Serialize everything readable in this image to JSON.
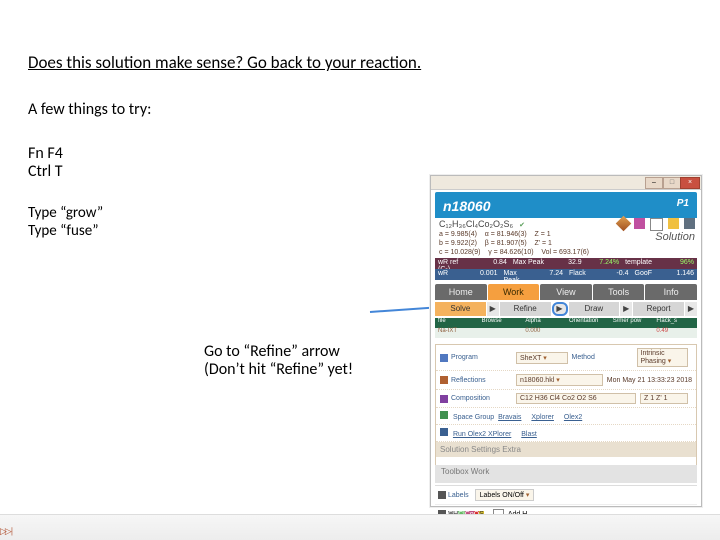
{
  "text": {
    "title": "Does this solution make sense? Go back to your reaction.",
    "subtitle": "A few things to try:",
    "l3": "Fn F4",
    "l4": "Ctrl T",
    "l5": "Type “grow”",
    "l6": "Type “fuse”",
    "l7": "Go to “Refine” arrow",
    "l8": "(Don’t hit “Refine” yet!"
  },
  "app": {
    "title": "n18060",
    "p1": "P1",
    "winbtns": {
      "min": "–",
      "max": "□",
      "close": "×"
    },
    "formula": "C₁₂H₃₆Cl₄Co₂O₂S₆",
    "unit_raw": "a = 9.985(4)    α = 81.946(3)    Z = 1\nb = 9.922(2)    β = 81.907(5)    Z' = 1\nc = 10.028(9)    γ = 84.626(10)    Vol = 693.17(6)",
    "sol_tag": "Solution",
    "stats": {
      "wrA": {
        "label": "wR ref (C-)",
        "val": "0.84"
      },
      "maxpA": {
        "label": "Max Peak",
        "val": "32.9"
      },
      "pct": "7.24%",
      "temp": {
        "label": "template",
        "val": "96%"
      },
      "wrB": {
        "label": "wR",
        "val": "0.001"
      },
      "maxpB": {
        "label": "Max Peak",
        "val": "7.24"
      },
      "flackB": {
        "label": "Flack",
        "val": "-0.4"
      },
      "goof": {
        "label": "GooF",
        "val": "1.146"
      }
    },
    "mainTabs": [
      "Home",
      "Work",
      "View",
      "Tools",
      "Info"
    ],
    "subTabs": [
      "Solve",
      "Refine",
      "Draw",
      "Report"
    ],
    "grid": {
      "head": [
        "file",
        "Browse",
        "Alpha",
        "Orientation",
        "S/mer pow",
        "Flack_s"
      ],
      "row": [
        "Na-IXT",
        "",
        "0.000",
        "",
        "",
        "0.49"
      ]
    },
    "fields": {
      "program": {
        "label": "Program",
        "val": "SheXT",
        "rlabel": "Method",
        "rval": "Intrinsic Phasing"
      },
      "reflections": {
        "label": "Reflections",
        "val": "n18060.hkl",
        "right": "Mon May 21 13:33:23 2018"
      },
      "composition": {
        "label": "Composition",
        "val": "C12 H36 Cl4 Co2 O2 S6",
        "right": "Z 1  Z' 1"
      }
    },
    "links": {
      "sg_label": "Space Group",
      "sg": [
        "Bravais",
        "Xplorer",
        "Olex2"
      ],
      "olexp_label": "Run Olex2 XPlorer",
      "blast": "Blast"
    },
    "extras": "Solution Settings Extra",
    "toolbox": "Toolbox Work",
    "bottom": {
      "labels_lbl": "Labels",
      "labels_val": "Labels ON/Off",
      "elems": [
        {
          "t": "C",
          "bg": "#777",
          "fg": "#fff"
        },
        {
          "t": "H",
          "bg": "#eee",
          "fg": "#444"
        },
        {
          "t": "Cl",
          "bg": "#6b6",
          "fg": "#fff"
        },
        {
          "t": "Co",
          "bg": "#c05080",
          "fg": "#fff"
        },
        {
          "t": "O",
          "bg": "#d83030",
          "fg": "#fff"
        },
        {
          "t": "S",
          "bg": "#d8c030",
          "fg": "#333"
        },
        {
          "t": "…",
          "bg": "#fff",
          "fg": "#444"
        }
      ],
      "addit": "Add H"
    }
  }
}
